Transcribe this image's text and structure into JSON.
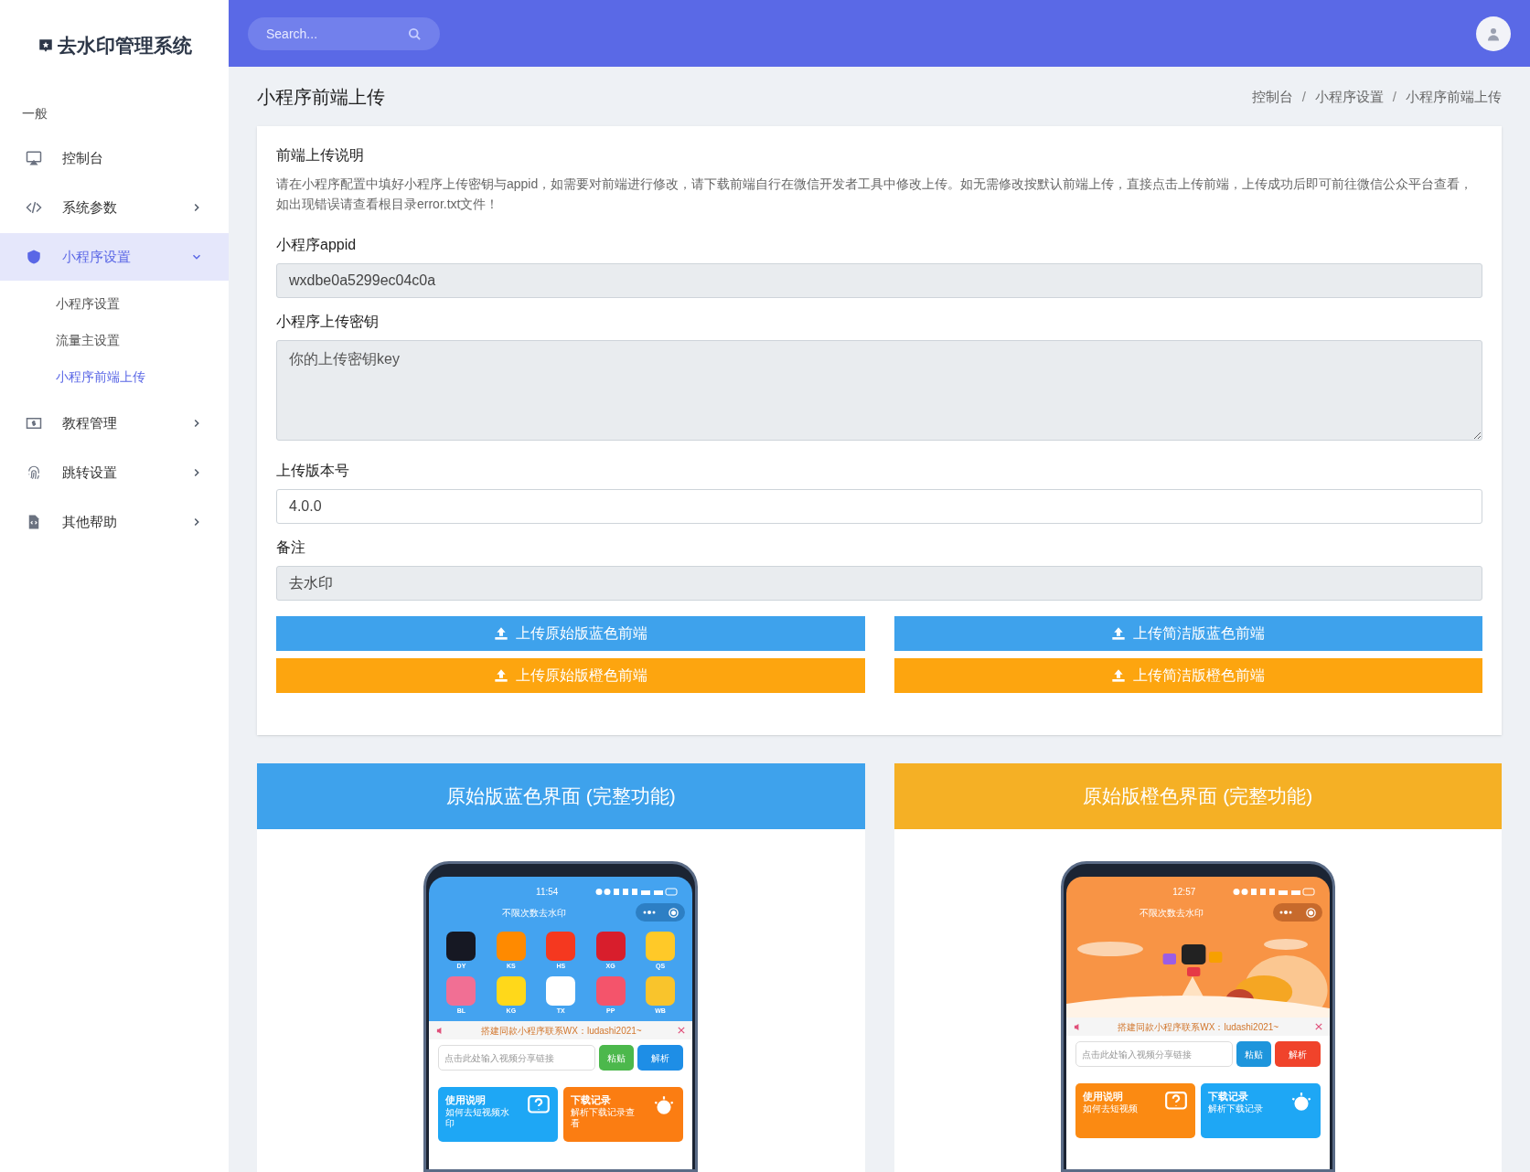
{
  "sidebar": {
    "logo": "去水印管理系统",
    "section": "一般",
    "items": [
      {
        "label": "控制台",
        "kind": "monitor",
        "selected": false
      },
      {
        "label": "系统参数",
        "kind": "code",
        "expanded": false,
        "selected": false,
        "has_children": true
      },
      {
        "label": "小程序设置",
        "kind": "shield",
        "expanded": true,
        "selected": true,
        "has_children": true,
        "children": [
          {
            "label": "小程序设置",
            "selected": false
          },
          {
            "label": "流量主设置",
            "selected": false
          },
          {
            "label": "小程序前端上传",
            "selected": true
          }
        ]
      },
      {
        "label": "教程管理",
        "kind": "money",
        "expanded": false,
        "selected": false,
        "has_children": true
      },
      {
        "label": "跳转设置",
        "kind": "fingerprint",
        "expanded": false,
        "selected": false,
        "has_children": true
      },
      {
        "label": "其他帮助",
        "kind": "file",
        "expanded": false,
        "selected": false,
        "has_children": true
      }
    ]
  },
  "header": {
    "search": {
      "placeholder": "Search..."
    }
  },
  "page": {
    "title": "小程序前端上传",
    "breadcrumb": [
      "控制台",
      "小程序设置",
      "小程序前端上传"
    ],
    "breadcrumb_separators": [
      "/",
      "/"
    ]
  },
  "form": {
    "notice_title": "前端上传说明",
    "notice": "请在小程序配置中填好小程序上传密钥与appid，如需要对前端进行修改，请下载前端自行在微信开发者工具中修改上传。如无需修改按默认前端上传，直接点击上传前端，上传成功后即可前往微信公众平台查看，如出现错误请查看根目录error.txt文件！",
    "fields": [
      {
        "label": "小程序appid",
        "kind": "input",
        "value": "wxdbe0a5299ec04c0a",
        "disabled": true
      },
      {
        "label": "小程序上传密钥",
        "kind": "textarea",
        "placeholder": "你的上传密钥key",
        "disabled": true
      },
      {
        "label": "上传版本号",
        "kind": "input",
        "value": "4.0.0",
        "disabled": false
      },
      {
        "label": "备注",
        "kind": "input",
        "value": "去水印",
        "disabled": true
      }
    ],
    "buttons": [
      {
        "label": "上传原始版蓝色前端",
        "color": "#3ea2ec"
      },
      {
        "label": "上传简洁版蓝色前端",
        "color": "#3ea2ec"
      },
      {
        "label": "上传原始版橙色前端",
        "color": "#fda50f"
      },
      {
        "label": "上传简洁版橙色前端",
        "color": "#fda50f"
      }
    ]
  },
  "previews": [
    {
      "title": "原始版蓝色界面 (完整功能)",
      "color": "#3ea2ec",
      "phone": {
        "kind": "blue",
        "time": "11:54",
        "app_title": "不限次数去水印",
        "apps": [
          {
            "label": "DY",
            "color": "#161823"
          },
          {
            "label": "KS",
            "color": "#ff8a00"
          },
          {
            "label": "HS",
            "color": "#f5381f"
          },
          {
            "label": "XG",
            "color": "#d81e2c"
          },
          {
            "label": "QS",
            "color": "#ffc928"
          },
          {
            "label": "BL",
            "color": "#f16f94"
          },
          {
            "label": "KG",
            "color": "#ffd81a"
          },
          {
            "label": "TX",
            "color": "#ffffff"
          },
          {
            "label": "PP",
            "color": "#f4546b"
          },
          {
            "label": "WB",
            "color": "#f9c42c"
          }
        ],
        "notice": "搭建同款小程序联系WX：ludashi2021~",
        "input_placeholder": "点击此处输入视频分享链接",
        "paste": "粘贴",
        "parse": "解析",
        "cards": [
          {
            "title": "使用说明",
            "subtitle": "如何去短视频水印",
            "color": "#1ea7f5"
          },
          {
            "title": "下载记录",
            "subtitle": "解析下载记录查看",
            "color": "#fb7d12"
          }
        ]
      }
    },
    {
      "title": "原始版橙色界面 (完整功能)",
      "color": "#f5b025",
      "phone": {
        "kind": "orange",
        "time": "12:57",
        "app_title": "不限次数去水印",
        "notice": "搭建同款小程序联系WX：ludashi2021~",
        "input_placeholder": "点击此处输入视频分享链接",
        "paste": "粘贴",
        "parse": "解析",
        "cards": [
          {
            "title": "使用说明",
            "subtitle": "如何去短视频",
            "color": "#fb8a12"
          },
          {
            "title": "下载记录",
            "subtitle": "解析下载记录",
            "color": "#1ea7f5"
          }
        ]
      }
    }
  ]
}
